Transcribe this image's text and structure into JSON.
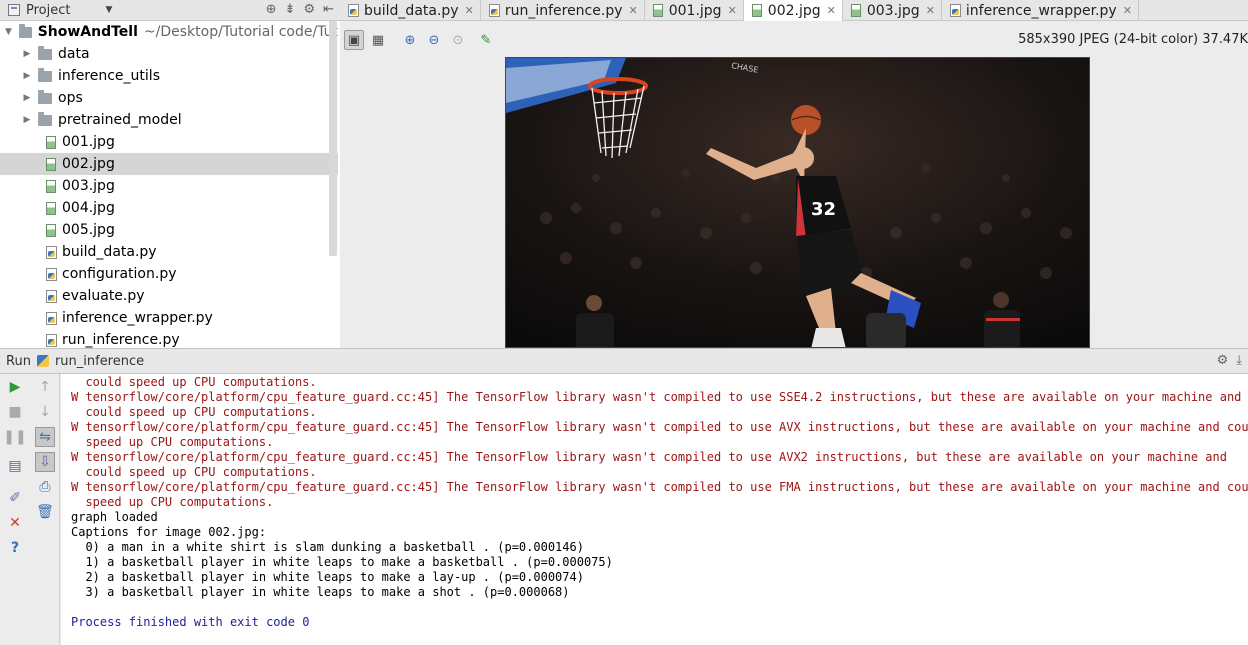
{
  "project_panel": {
    "title": "Project",
    "root": {
      "name": "ShowAndTell",
      "path": "~/Desktop/Tutorial code/Tut"
    },
    "items": [
      {
        "type": "folder",
        "label": "data"
      },
      {
        "type": "folder",
        "label": "inference_utils"
      },
      {
        "type": "folder",
        "label": "ops"
      },
      {
        "type": "folder",
        "label": "pretrained_model"
      },
      {
        "type": "jpg",
        "label": "001.jpg"
      },
      {
        "type": "jpg",
        "label": "002.jpg",
        "selected": true
      },
      {
        "type": "jpg",
        "label": "003.jpg"
      },
      {
        "type": "jpg",
        "label": "004.jpg"
      },
      {
        "type": "jpg",
        "label": "005.jpg"
      },
      {
        "type": "py",
        "label": "build_data.py"
      },
      {
        "type": "py",
        "label": "configuration.py"
      },
      {
        "type": "py",
        "label": "evaluate.py"
      },
      {
        "type": "py",
        "label": "inference_wrapper.py"
      },
      {
        "type": "py",
        "label": "run_inference.py"
      }
    ]
  },
  "tabs": [
    {
      "label": "build_data.py",
      "type": "py"
    },
    {
      "label": "run_inference.py",
      "type": "py"
    },
    {
      "label": "001.jpg",
      "type": "jpg"
    },
    {
      "label": "002.jpg",
      "type": "jpg",
      "active": true
    },
    {
      "label": "003.jpg",
      "type": "jpg"
    },
    {
      "label": "inference_wrapper.py",
      "type": "py"
    }
  ],
  "image_viewer": {
    "info": "585x390 JPEG (24-bit color) 37.47K",
    "jersey_number": "32",
    "banner_text": "CHASE"
  },
  "run_panel": {
    "label": "Run",
    "config": "run_inference",
    "console_lines": [
      {
        "kind": "err",
        "text": "  could speed up CPU computations."
      },
      {
        "kind": "err",
        "text": "W tensorflow/core/platform/cpu_feature_guard.cc:45] The TensorFlow library wasn't compiled to use SSE4.2 instructions, but these are available on your machine and"
      },
      {
        "kind": "err",
        "text": "  could speed up CPU computations."
      },
      {
        "kind": "err",
        "text": "W tensorflow/core/platform/cpu_feature_guard.cc:45] The TensorFlow library wasn't compiled to use AVX instructions, but these are available on your machine and could"
      },
      {
        "kind": "err",
        "text": "  speed up CPU computations."
      },
      {
        "kind": "err",
        "text": "W tensorflow/core/platform/cpu_feature_guard.cc:45] The TensorFlow library wasn't compiled to use AVX2 instructions, but these are available on your machine and"
      },
      {
        "kind": "err",
        "text": "  could speed up CPU computations."
      },
      {
        "kind": "err",
        "text": "W tensorflow/core/platform/cpu_feature_guard.cc:45] The TensorFlow library wasn't compiled to use FMA instructions, but these are available on your machine and could"
      },
      {
        "kind": "err",
        "text": "  speed up CPU computations."
      },
      {
        "kind": "out",
        "text": "graph loaded"
      },
      {
        "kind": "out",
        "text": "Captions for image 002.jpg:"
      },
      {
        "kind": "out",
        "text": "  0) a man in a white shirt is slam dunking a basketball . (p=0.000146)"
      },
      {
        "kind": "out",
        "text": "  1) a basketball player in white leaps to make a basketball . (p=0.000075)"
      },
      {
        "kind": "out",
        "text": "  2) a basketball player in white leaps to make a lay-up . (p=0.000074)"
      },
      {
        "kind": "out",
        "text": "  3) a basketball player in white leaps to make a shot . (p=0.000068)"
      },
      {
        "kind": "out",
        "text": ""
      },
      {
        "kind": "fin",
        "text": "Process finished with exit code 0"
      }
    ]
  }
}
